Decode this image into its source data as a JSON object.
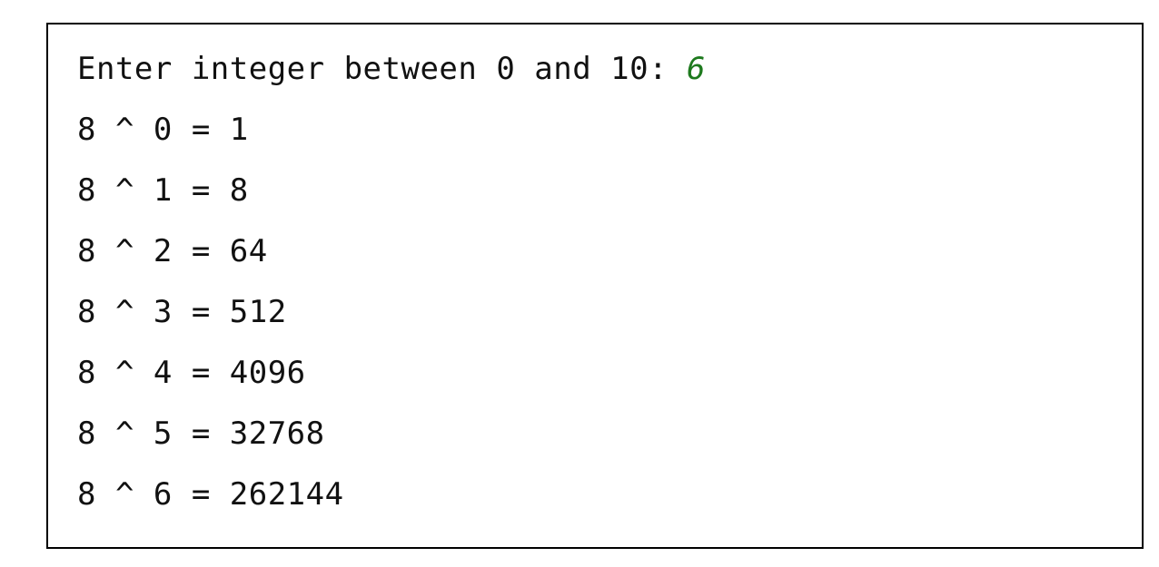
{
  "console": {
    "prompt": "Enter integer between 0 and 10: ",
    "input_value": "6",
    "output_lines": [
      "8 ^ 0 = 1",
      "8 ^ 1 = 8",
      "8 ^ 2 = 64",
      "8 ^ 3 = 512",
      "8 ^ 4 = 4096",
      "8 ^ 5 = 32768",
      "8 ^ 6 = 262144"
    ]
  },
  "colors": {
    "text": "#111111",
    "input": "#1e7a1e",
    "border": "#000000",
    "background": "#ffffff"
  }
}
